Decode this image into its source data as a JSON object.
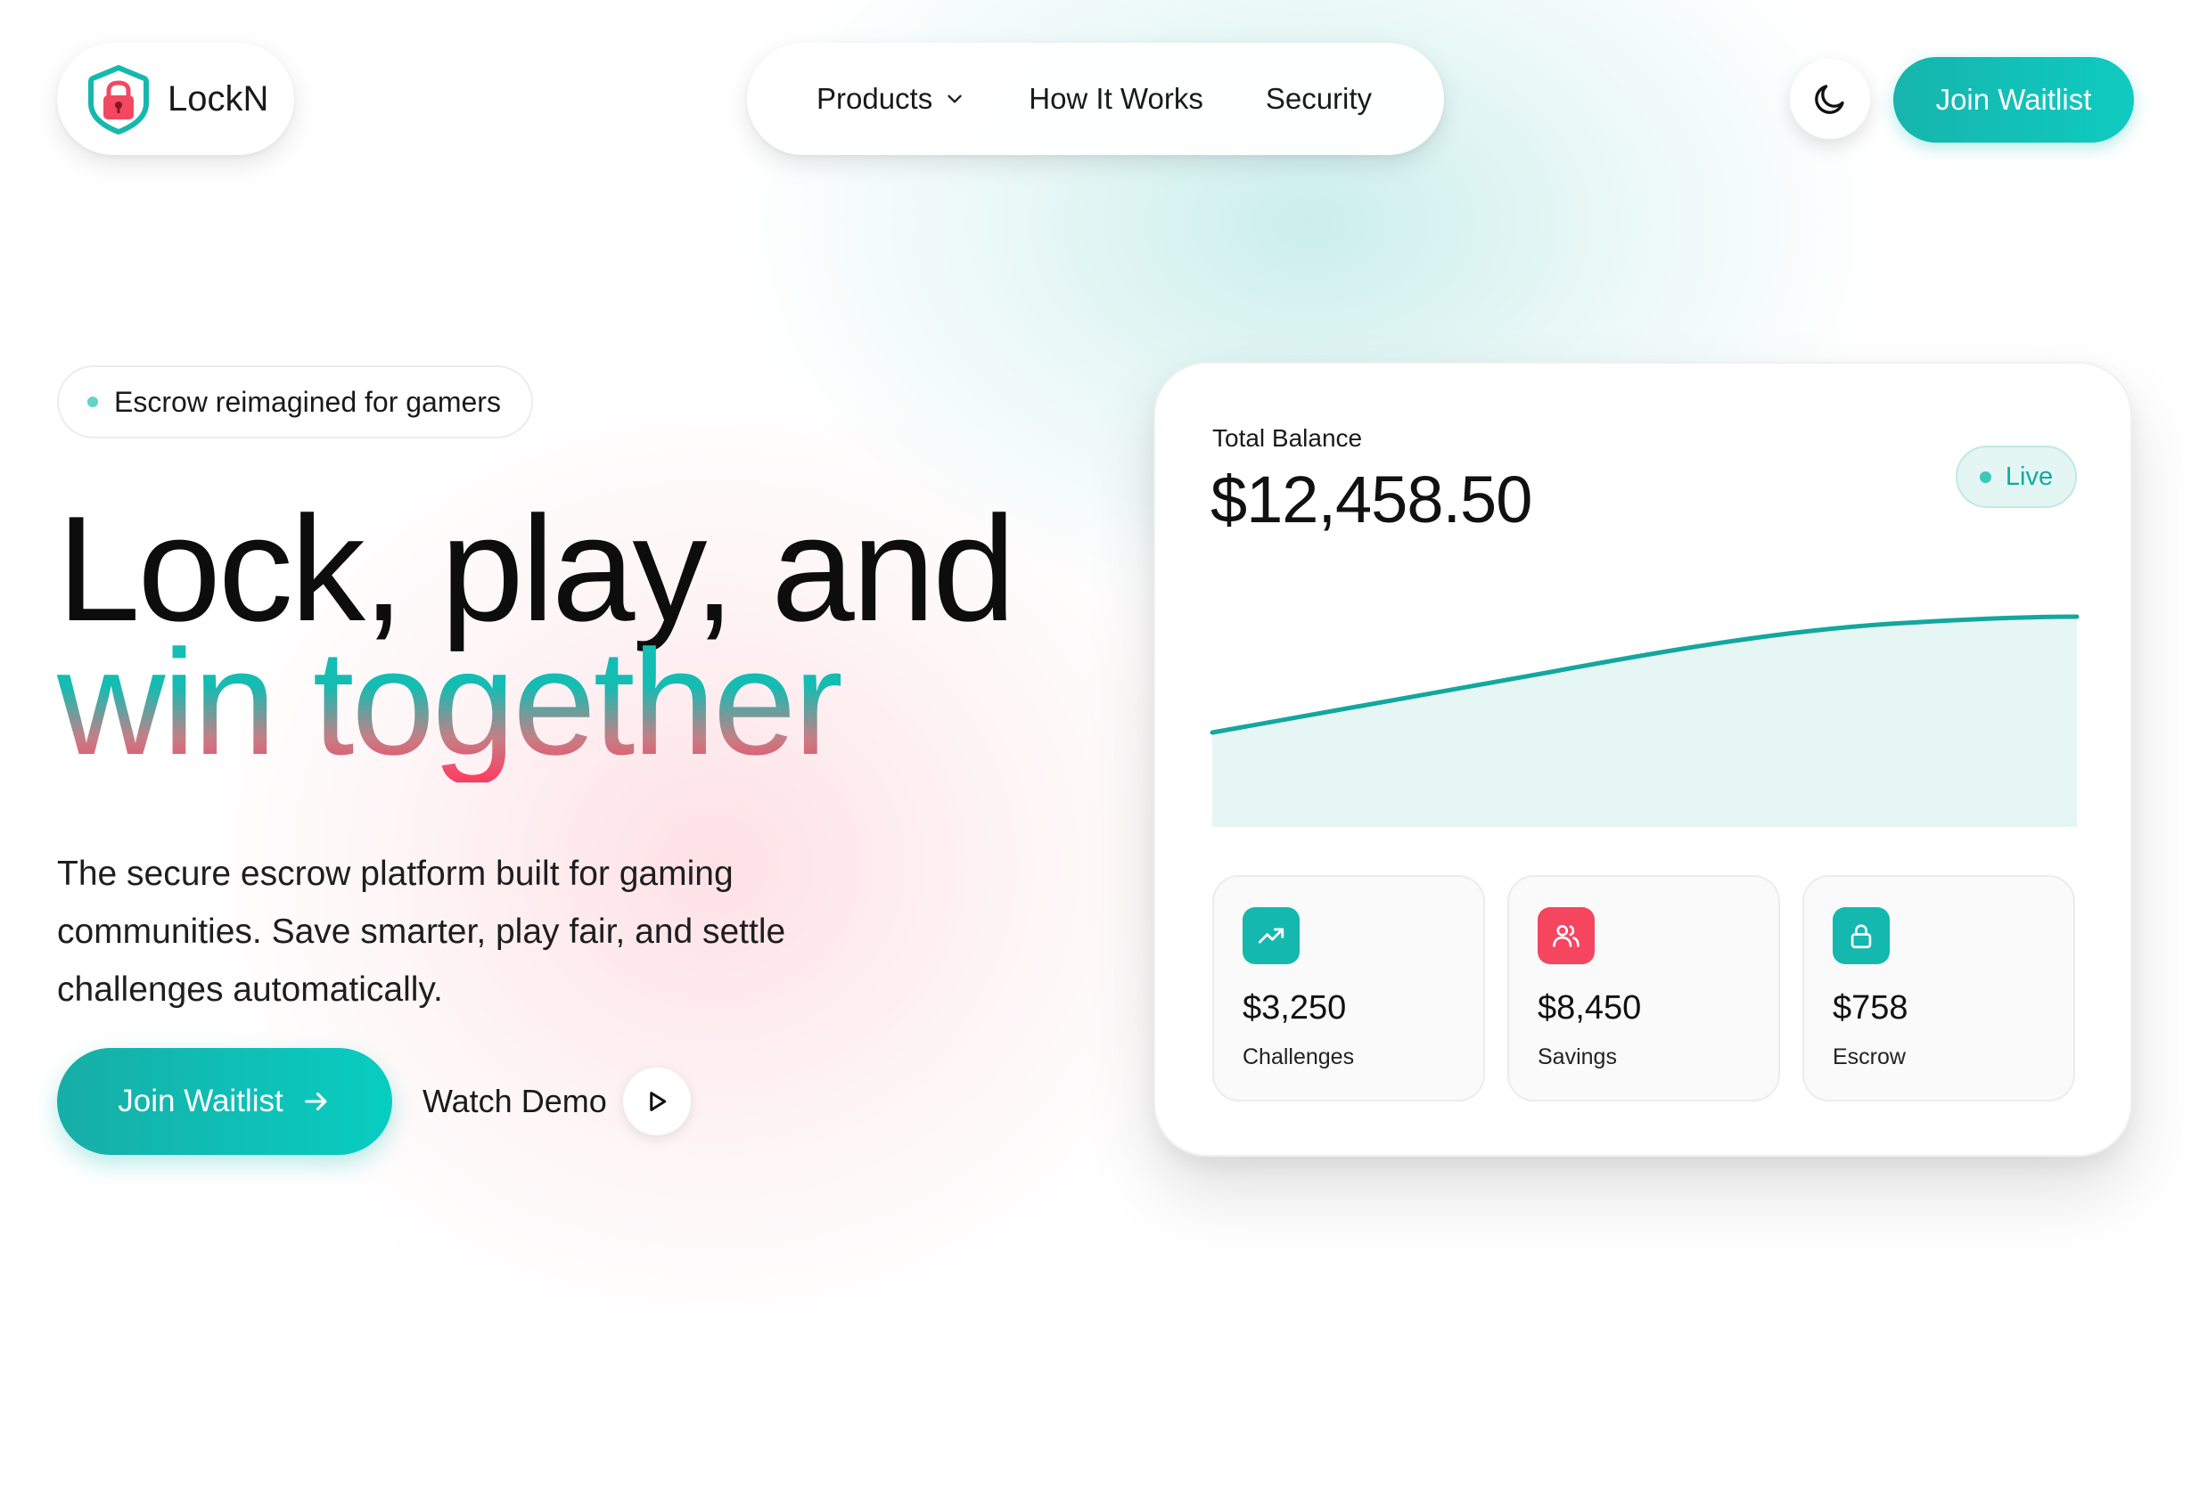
{
  "brand": {
    "name": "LockN",
    "logo_icon": "shield-lock-icon"
  },
  "nav": {
    "items": [
      {
        "label": "Products",
        "has_dropdown": true
      },
      {
        "label": "How It Works"
      },
      {
        "label": "Security"
      }
    ]
  },
  "header": {
    "theme_toggle_icon": "moon-icon",
    "join_label": "Join Waitlist"
  },
  "hero": {
    "tag": "Escrow reimagined for gamers",
    "headline_line1": "Lock, play, and",
    "headline_line2": "win together",
    "subcopy": "The secure escrow platform built for gaming communities. Save smarter, play fair, and settle challenges automatically.",
    "primary_cta": "Join Waitlist",
    "secondary_cta": "Watch Demo"
  },
  "card": {
    "label": "Total Balance",
    "balance": "$12,458.50",
    "status": "Live",
    "stats": [
      {
        "value": "$3,250",
        "label": "Challenges",
        "icon": "trending-up-icon",
        "color": "#14b8ae"
      },
      {
        "value": "$8,450",
        "label": "Savings",
        "icon": "users-icon",
        "color": "#f5455f"
      },
      {
        "value": "$758",
        "label": "Escrow",
        "icon": "lock-icon",
        "color": "#14b8ae"
      }
    ]
  },
  "colors": {
    "accent_teal": "#12bfb5",
    "accent_pink": "#ff3b5f",
    "chart_line": "#13a79e",
    "chart_fill": "#e6f6f4"
  }
}
